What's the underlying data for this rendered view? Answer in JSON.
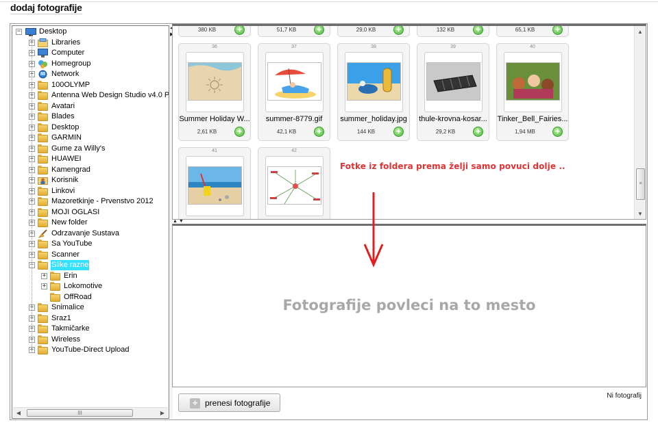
{
  "page": {
    "title": "dodaj fotografije"
  },
  "tree": {
    "root": "Desktop",
    "items": [
      {
        "label": "Libraries",
        "icon": "libraries-icon"
      },
      {
        "label": "Computer",
        "icon": "computer-icon"
      },
      {
        "label": "Homegroup",
        "icon": "homegroup-icon"
      },
      {
        "label": "Network",
        "icon": "network-icon"
      },
      {
        "label": "100OLYMP",
        "icon": "folder-icon"
      },
      {
        "label": "Antenna Web Design Studio v4.0 Por",
        "icon": "folder-icon"
      },
      {
        "label": "Avatari",
        "icon": "folder-icon"
      },
      {
        "label": "Blades",
        "icon": "folder-icon"
      },
      {
        "label": "Desktop",
        "icon": "folder-icon"
      },
      {
        "label": "GARMIN",
        "icon": "folder-icon"
      },
      {
        "label": "Gume za Willy's",
        "icon": "folder-icon"
      },
      {
        "label": "HUAWEI",
        "icon": "folder-icon"
      },
      {
        "label": "Kamengrad",
        "icon": "folder-icon"
      },
      {
        "label": "Korisnik",
        "icon": "user-folder-icon"
      },
      {
        "label": "Linkovi",
        "icon": "folder-icon"
      },
      {
        "label": "Mazoretkinje - Prvenstvo 2012",
        "icon": "folder-icon"
      },
      {
        "label": "MOJI OGLASI",
        "icon": "folder-icon"
      },
      {
        "label": "New folder",
        "icon": "folder-icon"
      },
      {
        "label": "Odrzavanje Sustava",
        "icon": "broom-icon"
      },
      {
        "label": "Sa YouTube",
        "icon": "folder-icon"
      },
      {
        "label": "Scanner",
        "icon": "folder-icon"
      },
      {
        "label": "Slike razne",
        "icon": "folder-icon",
        "selected": true
      },
      {
        "label": "Erin",
        "icon": "folder-icon",
        "child": true
      },
      {
        "label": "Lokomotive",
        "icon": "folder-icon",
        "child": true
      },
      {
        "label": "OffRoad",
        "icon": "folder-icon",
        "child": true,
        "leaf": true
      },
      {
        "label": "Snimalice",
        "icon": "folder-icon"
      },
      {
        "label": "Sraz1",
        "icon": "folder-icon"
      },
      {
        "label": "Takmičarke",
        "icon": "folder-icon"
      },
      {
        "label": "Wireless",
        "icon": "folder-icon"
      },
      {
        "label": "YouTube-Direct Upload",
        "icon": "folder-icon"
      }
    ],
    "hscroll_grip": "III"
  },
  "thumbs_top_row": [
    {
      "size": "380 KB"
    },
    {
      "size": "51,7 KB"
    },
    {
      "size": "29,0 KB"
    },
    {
      "size": "132 KB"
    },
    {
      "size": "65,1 KB"
    }
  ],
  "thumbs": [
    {
      "num": "36",
      "name": "Summer Holiday W...",
      "size": "2,61 KB"
    },
    {
      "num": "37",
      "name": "summer-8779.gif",
      "size": "42,1 KB"
    },
    {
      "num": "38",
      "name": "summer_holiday.jpg",
      "size": "144 KB"
    },
    {
      "num": "39",
      "name": "thule-krovna-kosar...",
      "size": "29,2 KB"
    },
    {
      "num": "40",
      "name": "Tinker_Bell_Fairies...",
      "size": "1,94 MB"
    },
    {
      "num": "41",
      "name": "",
      "size": ""
    },
    {
      "num": "42",
      "name": "",
      "size": ""
    }
  ],
  "hint": "Fotke iz foldera prema želji samo povuci dolje ..",
  "dropzone": {
    "text": "Fotografije povleci na to mesto"
  },
  "upload_button": {
    "label": "prenesi fotografije"
  },
  "status": "Ni fotografij",
  "colors": {
    "hint": "#e03232",
    "arrow": "#e02020",
    "selection": "#33e0ff",
    "add": "#49b53c"
  }
}
